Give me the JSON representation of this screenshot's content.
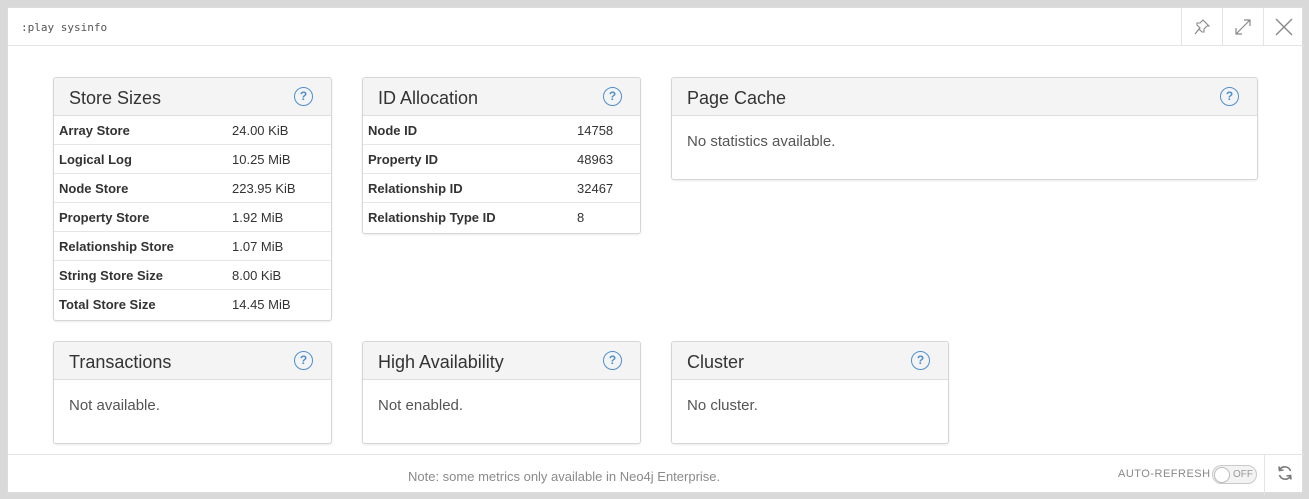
{
  "command": ":play sysinfo",
  "header_icons": [
    "pin-icon",
    "expand-icon",
    "close-icon"
  ],
  "store_sizes": {
    "title": "Store Sizes",
    "rows": [
      {
        "label": "Array Store",
        "value": "24.00 KiB"
      },
      {
        "label": "Logical Log",
        "value": "10.25 MiB"
      },
      {
        "label": "Node Store",
        "value": "223.95 KiB"
      },
      {
        "label": "Property Store",
        "value": "1.92 MiB"
      },
      {
        "label": "Relationship Store",
        "value": "1.07 MiB"
      },
      {
        "label": "String Store Size",
        "value": "8.00 KiB"
      },
      {
        "label": "Total Store Size",
        "value": "14.45 MiB"
      }
    ]
  },
  "id_allocation": {
    "title": "ID Allocation",
    "rows": [
      {
        "label": "Node ID",
        "value": "14758"
      },
      {
        "label": "Property ID",
        "value": "48963"
      },
      {
        "label": "Relationship ID",
        "value": "32467"
      },
      {
        "label": "Relationship Type ID",
        "value": "8"
      }
    ]
  },
  "page_cache": {
    "title": "Page Cache",
    "message": "No statistics available."
  },
  "transactions": {
    "title": "Transactions",
    "message": "Not available."
  },
  "high_availability": {
    "title": "High Availability",
    "message": "Not enabled."
  },
  "cluster": {
    "title": "Cluster",
    "message": "No cluster."
  },
  "footer": {
    "note": "Note: some metrics only available in Neo4j Enterprise.",
    "auto_refresh_label": "AUTO-REFRESH",
    "toggle_state": "OFF"
  },
  "colors": {
    "accent": "#4d8fd1",
    "panel_header": "#f4f4f4"
  }
}
